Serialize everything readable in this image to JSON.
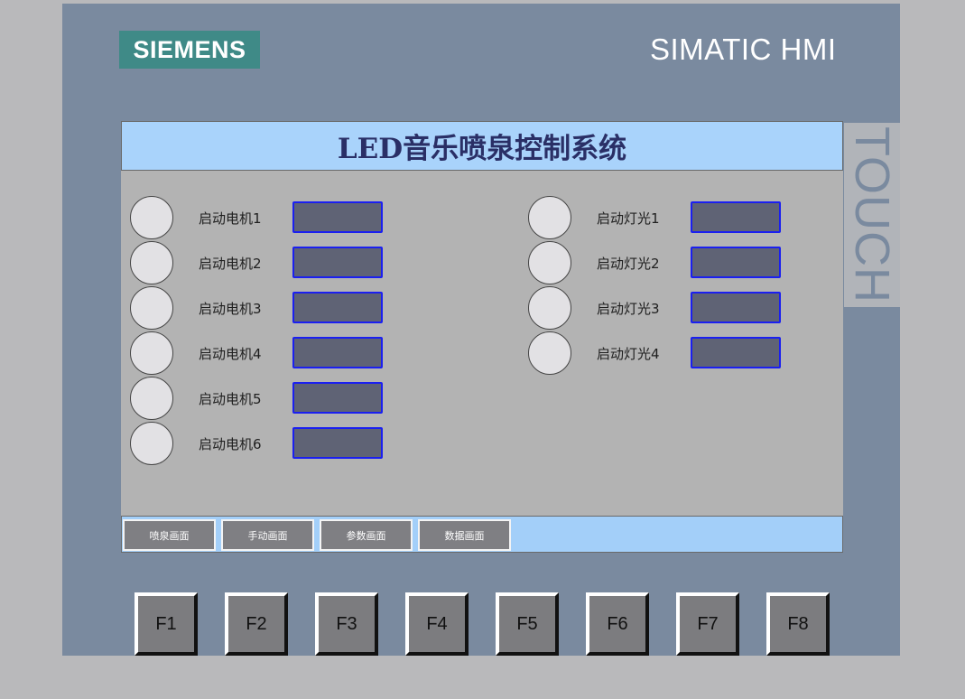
{
  "branding": {
    "logo_text": "SIEMENS",
    "model_text": "SIMATIC HMI",
    "touch_text": "TOUCH"
  },
  "screen": {
    "title": "LED音乐喷泉控制系统",
    "motors": [
      {
        "label": "启动电机1"
      },
      {
        "label": "启动电机2"
      },
      {
        "label": "启动电机3"
      },
      {
        "label": "启动电机4"
      },
      {
        "label": "启动电机5"
      },
      {
        "label": "启动电机6"
      }
    ],
    "lights": [
      {
        "label": "启动灯光1"
      },
      {
        "label": "启动灯光2"
      },
      {
        "label": "启动灯光3"
      },
      {
        "label": "启动灯光4"
      }
    ],
    "nav_buttons": [
      {
        "label": "喷泉画面"
      },
      {
        "label": "手动画面"
      },
      {
        "label": "参数画面"
      },
      {
        "label": "数据画面"
      }
    ]
  },
  "function_keys": [
    "F1",
    "F2",
    "F3",
    "F4",
    "F5",
    "F6",
    "F7",
    "F8"
  ],
  "colors": {
    "bezel": "#7a8a9f",
    "logo_bg": "#3f8a87",
    "title_bar": "#a9d3fb",
    "io_field_bg": "#5f6375",
    "io_field_border": "#1a1ff0",
    "lamp_off": "#e2e1e4"
  }
}
